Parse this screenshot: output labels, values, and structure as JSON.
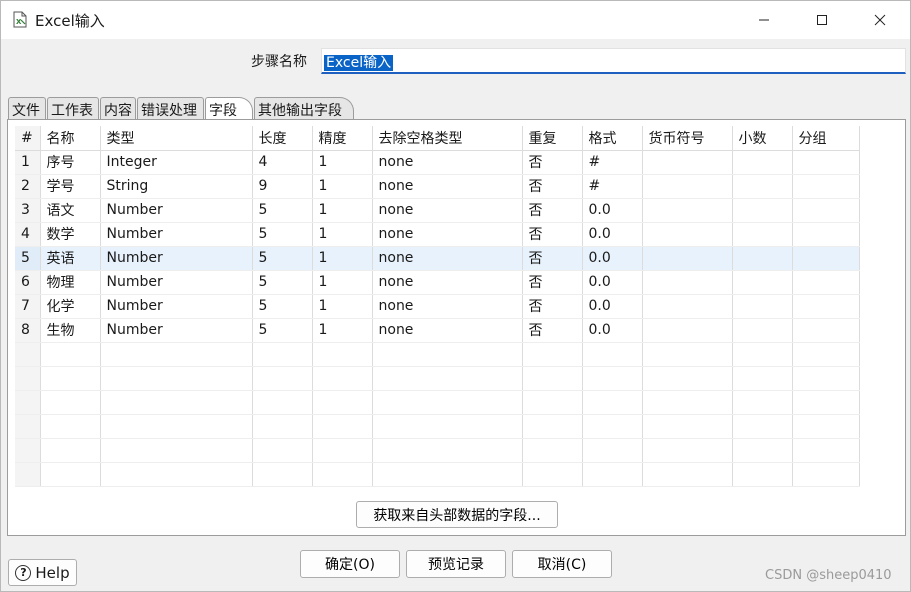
{
  "window": {
    "title": "Excel输入",
    "icon": "excel-input-icon"
  },
  "step": {
    "label": "步骤名称",
    "value": "Excel输入"
  },
  "tabs": [
    {
      "label": "文件",
      "active": false
    },
    {
      "label": "工作表",
      "active": false
    },
    {
      "label": "内容",
      "active": false
    },
    {
      "label": "错误处理",
      "active": false
    },
    {
      "label": "字段",
      "active": true
    },
    {
      "label": "其他输出字段",
      "active": false
    }
  ],
  "grid": {
    "headers": [
      "#",
      "名称",
      "类型",
      "长度",
      "精度",
      "去除空格类型",
      "重复",
      "格式",
      "货币符号",
      "小数",
      "分组"
    ],
    "rows": [
      {
        "num": "1",
        "name": "序号",
        "type": "Integer",
        "length": "4",
        "precision": "1",
        "trim": "none",
        "repeat": "否",
        "format": "#",
        "currency": "",
        "decimal": "",
        "group": ""
      },
      {
        "num": "2",
        "name": "学号",
        "type": "String",
        "length": "9",
        "precision": "1",
        "trim": "none",
        "repeat": "否",
        "format": "#",
        "currency": "",
        "decimal": "",
        "group": ""
      },
      {
        "num": "3",
        "name": "语文",
        "type": "Number",
        "length": "5",
        "precision": "1",
        "trim": "none",
        "repeat": "否",
        "format": "0.0",
        "currency": "",
        "decimal": "",
        "group": ""
      },
      {
        "num": "4",
        "name": "数学",
        "type": "Number",
        "length": "5",
        "precision": "1",
        "trim": "none",
        "repeat": "否",
        "format": "0.0",
        "currency": "",
        "decimal": "",
        "group": ""
      },
      {
        "num": "5",
        "name": "英语",
        "type": "Number",
        "length": "5",
        "precision": "1",
        "trim": "none",
        "repeat": "否",
        "format": "0.0",
        "currency": "",
        "decimal": "",
        "group": ""
      },
      {
        "num": "6",
        "name": "物理",
        "type": "Number",
        "length": "5",
        "precision": "1",
        "trim": "none",
        "repeat": "否",
        "format": "0.0",
        "currency": "",
        "decimal": "",
        "group": ""
      },
      {
        "num": "7",
        "name": "化学",
        "type": "Number",
        "length": "5",
        "precision": "1",
        "trim": "none",
        "repeat": "否",
        "format": "0.0",
        "currency": "",
        "decimal": "",
        "group": ""
      },
      {
        "num": "8",
        "name": "生物",
        "type": "Number",
        "length": "5",
        "precision": "1",
        "trim": "none",
        "repeat": "否",
        "format": "0.0",
        "currency": "",
        "decimal": "",
        "group": ""
      }
    ],
    "selected_row": "5"
  },
  "buttons": {
    "get_fields": "获取来自头部数据的字段...",
    "help": "Help",
    "ok": "确定(O)",
    "preview": "预览记录",
    "cancel": "取消(C)"
  },
  "watermark": "CSDN @sheep0410",
  "colors": {
    "selection": "#0a64c8",
    "selected_row": "#e8f2fc",
    "input_focus": "#1f5fbf"
  }
}
